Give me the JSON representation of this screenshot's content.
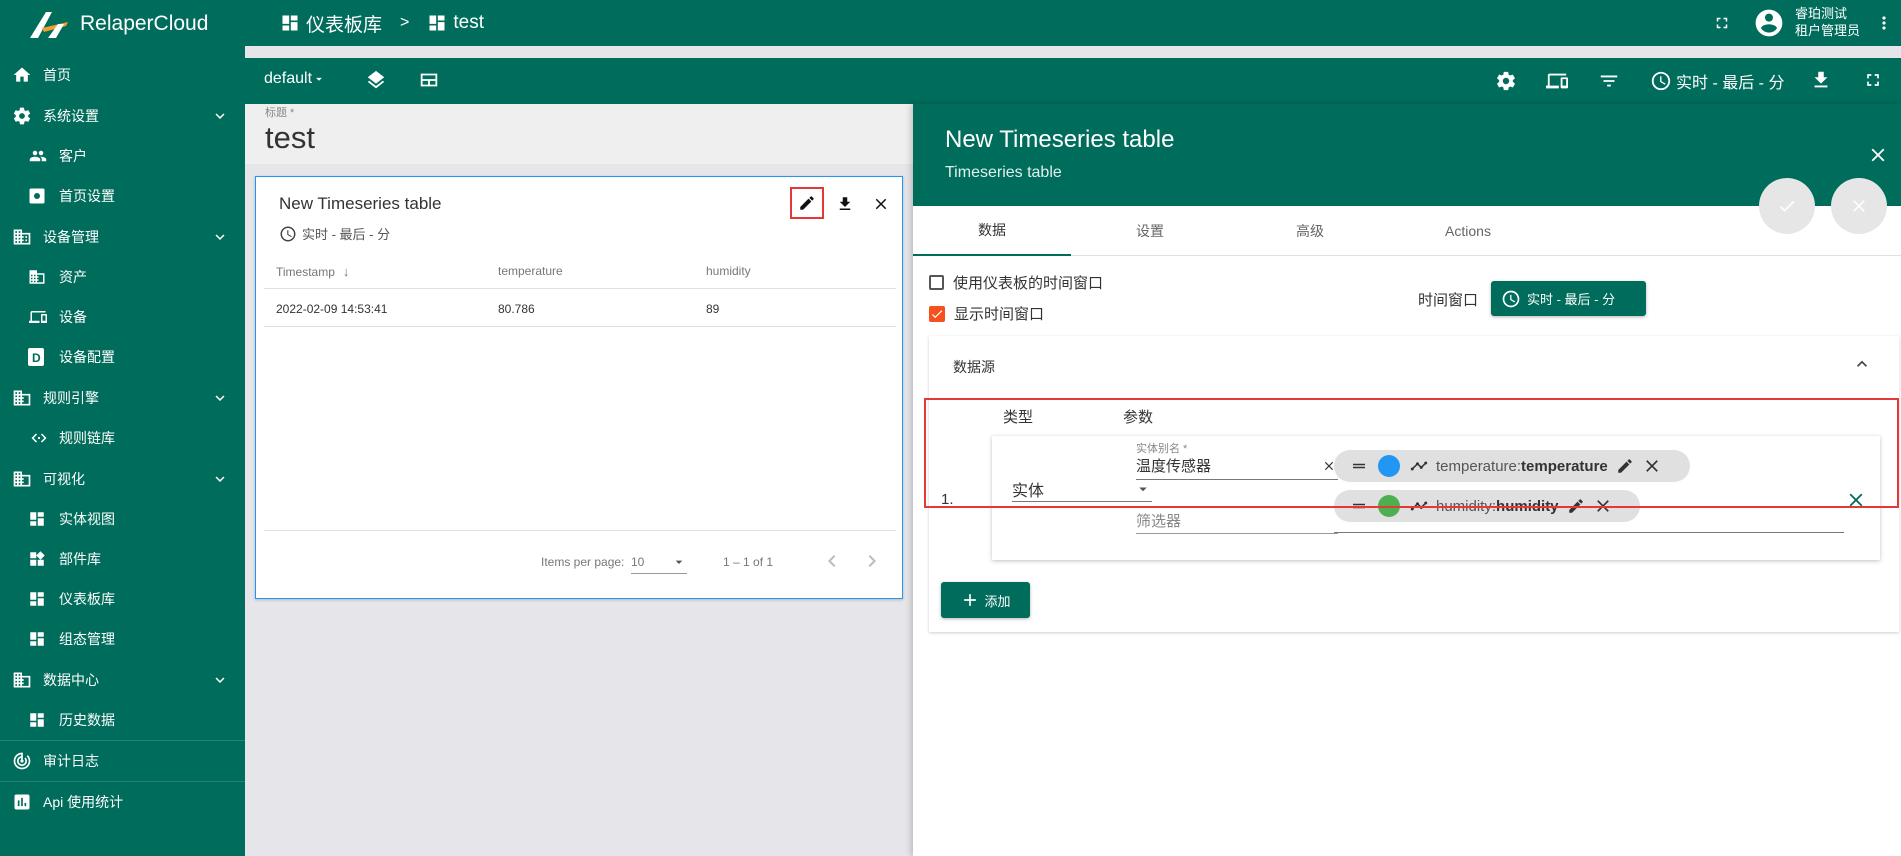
{
  "app": {
    "logo_text": "RelaperCloud"
  },
  "sidebar": {
    "items": [
      {
        "label": "首页"
      },
      {
        "label": "系统设置"
      },
      {
        "label": "客户"
      },
      {
        "label": "首页设置"
      },
      {
        "label": "设备管理"
      },
      {
        "label": "资产"
      },
      {
        "label": "设备"
      },
      {
        "label": "设备配置"
      },
      {
        "label": "规则引擎"
      },
      {
        "label": "规则链库"
      },
      {
        "label": "可视化"
      },
      {
        "label": "实体视图"
      },
      {
        "label": "部件库"
      },
      {
        "label": "仪表板库"
      },
      {
        "label": "组态管理"
      },
      {
        "label": "数据中心"
      },
      {
        "label": "历史数据"
      },
      {
        "label": "审计日志"
      },
      {
        "label": "Api 使用统计"
      }
    ]
  },
  "header": {
    "breadcrumb": {
      "root": "仪表板库",
      "separator": ">",
      "current": "test"
    },
    "user": {
      "name": "睿珀测试",
      "role": "租户管理员"
    }
  },
  "toolbar": {
    "state_label": "default",
    "timewindow": "实时 - 最后 - 分"
  },
  "dashboard": {
    "title_label": "标题 *",
    "title_value": "test"
  },
  "widget": {
    "title": "New Timeseries table",
    "timewindow": "实时 - 最后 - 分",
    "columns": [
      "Timestamp",
      "temperature",
      "humidity"
    ],
    "sort_arrow": "↓",
    "rows": [
      [
        "2022-02-09 14:53:41",
        "80.786",
        "89"
      ]
    ],
    "paginator": {
      "items_per_page_label": "Items per page:",
      "page_size": "10",
      "range": "1 – 1 of 1"
    }
  },
  "editor": {
    "title": "New Timeseries table",
    "subtitle": "Timeseries table",
    "tabs": [
      "数据",
      "设置",
      "高级",
      "Actions"
    ],
    "use_dashboard_timewindow": "使用仪表板的时间窗口",
    "display_timewindow": "显示时间窗口",
    "timewindow_label": "时间窗口",
    "timewindow_value": "实时 - 最后 - 分",
    "datasources_title": "数据源",
    "col_type": "类型",
    "col_params": "参数",
    "datasource": {
      "index": "1.",
      "type": "实体",
      "alias_label": "实体别名 *",
      "alias_value": "温度传感器",
      "filter_placeholder": "筛选器",
      "keys": [
        {
          "label": "temperature: ",
          "name": "temperature",
          "color": "#2196f3"
        },
        {
          "label": "humidity: ",
          "name": "humidity",
          "color": "#4caf50"
        }
      ]
    },
    "add_button": "添加"
  },
  "colors": {
    "primary": "#006c5b",
    "highlight": "#e53935",
    "widget_border": "#2196f3"
  }
}
